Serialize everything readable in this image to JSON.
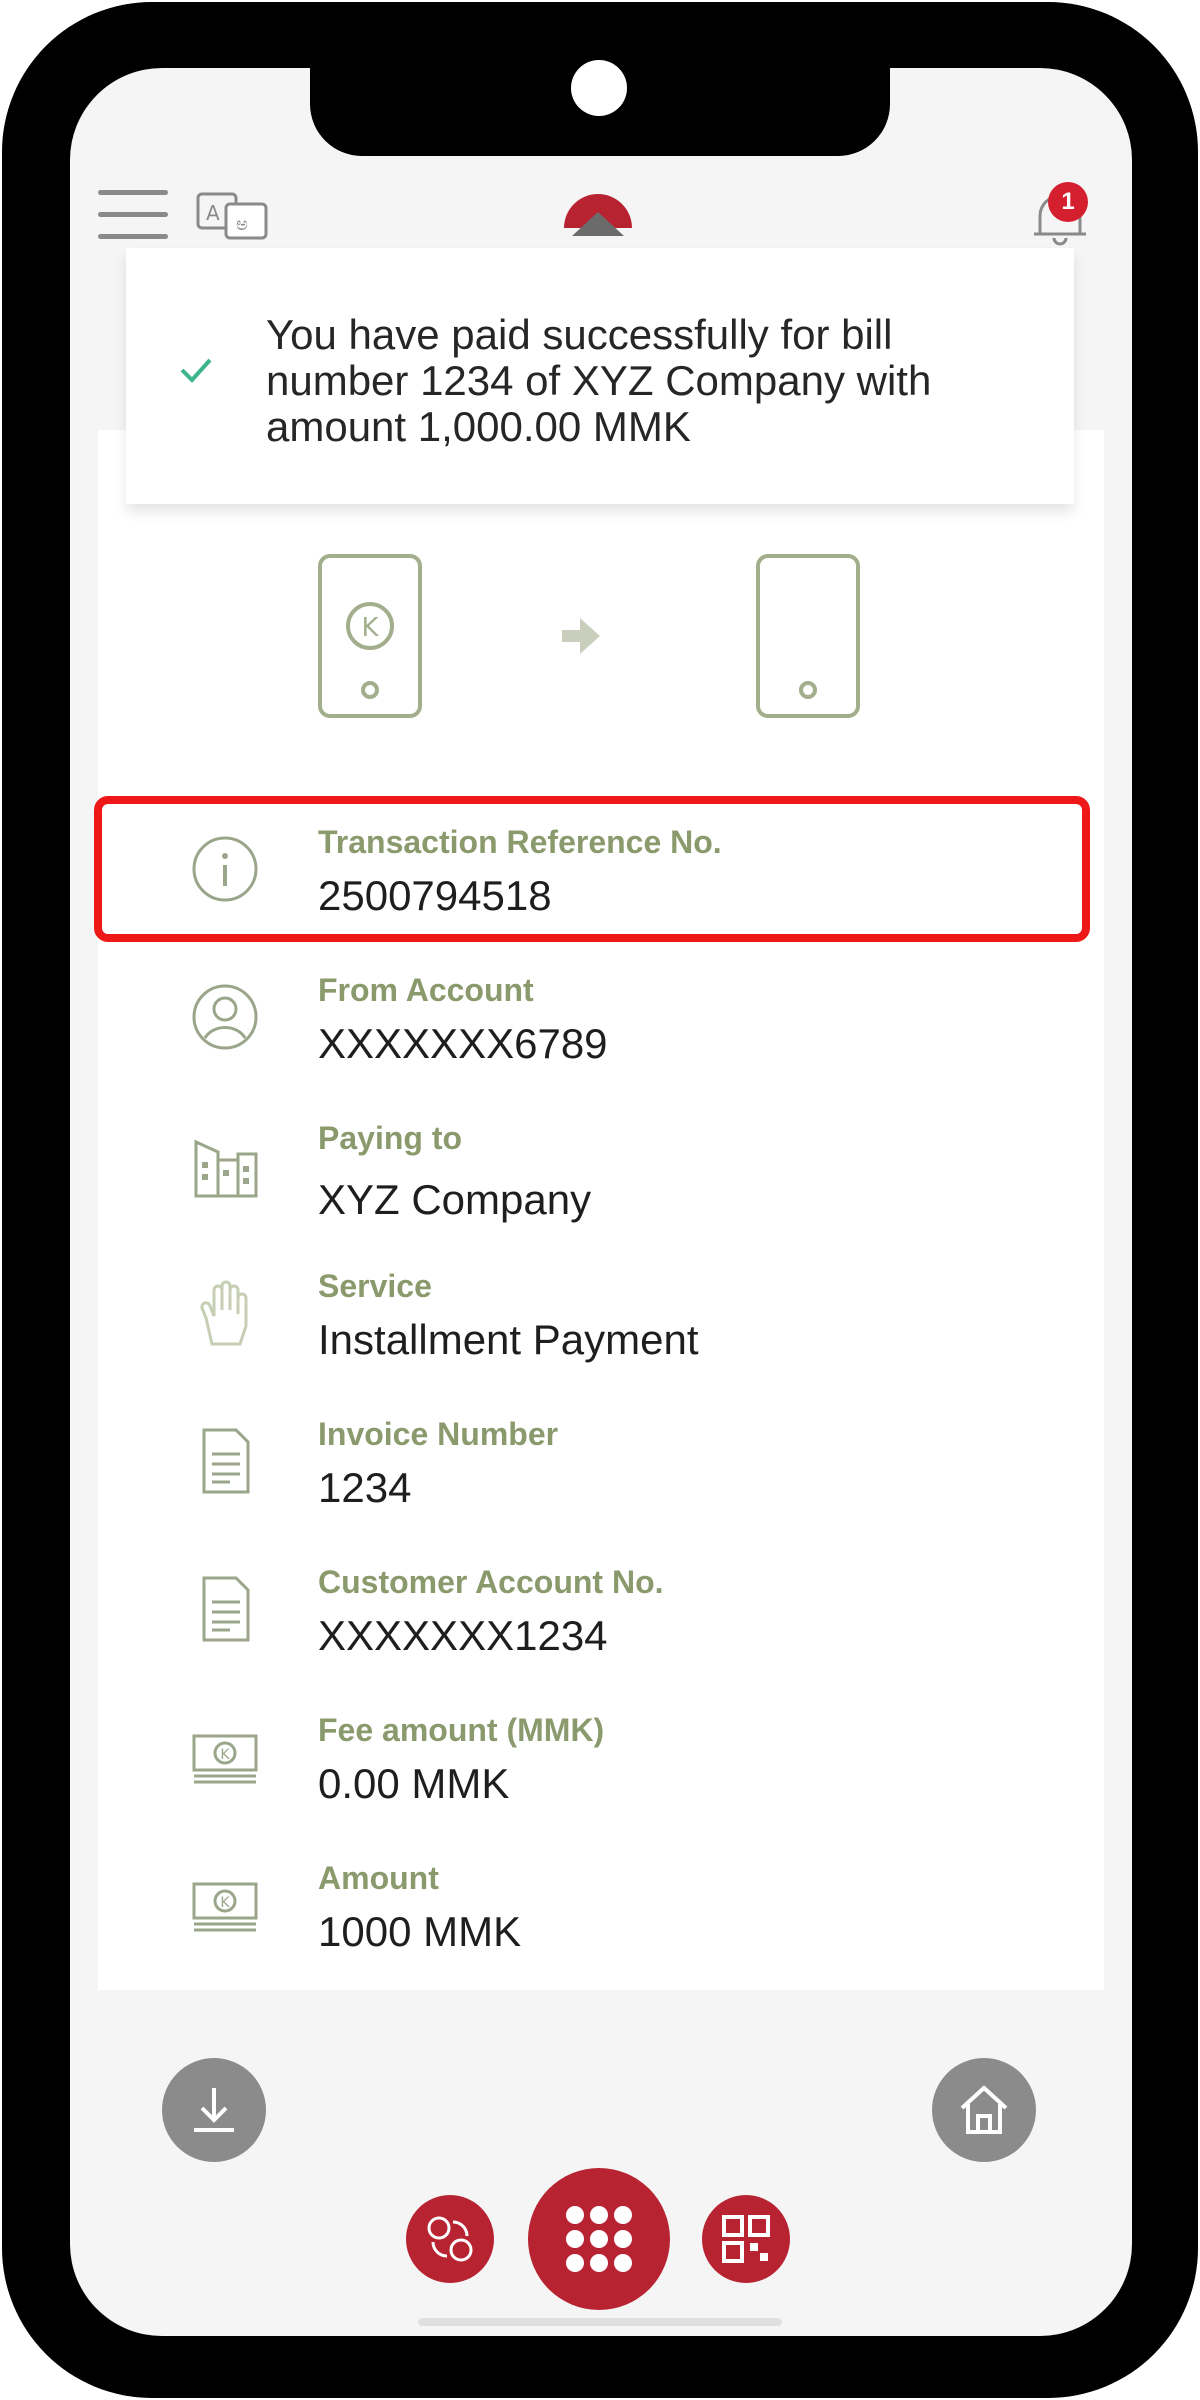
{
  "toast": {
    "message": "You have paid successfully for bill number 1234 of XYZ Company with amount 1,000.00 MMK"
  },
  "header": {
    "notification_count": "1"
  },
  "details": [
    {
      "label": "Transaction Reference No.",
      "value": "2500794518",
      "icon": "info-icon"
    },
    {
      "label": "From Account",
      "value": "XXXXXXX6789",
      "icon": "user-icon"
    },
    {
      "label": "Paying to",
      "value": "XYZ Company",
      "icon": "building-icon"
    },
    {
      "label": "Service",
      "value": "Installment Payment",
      "icon": "hand-icon"
    },
    {
      "label": "Invoice Number",
      "value": "1234",
      "icon": "document-icon"
    },
    {
      "label": "Customer Account No.",
      "value": "XXXXXXX1234",
      "icon": "document-icon"
    },
    {
      "label": "Fee amount (MMK)",
      "value": "0.00 MMK",
      "icon": "money-icon"
    },
    {
      "label": "Amount",
      "value": "1000 MMK",
      "icon": "money-icon"
    }
  ],
  "colors": {
    "accent": "#b82332",
    "label_green": "#8a9a6c",
    "highlight_border": "#ee1818"
  }
}
